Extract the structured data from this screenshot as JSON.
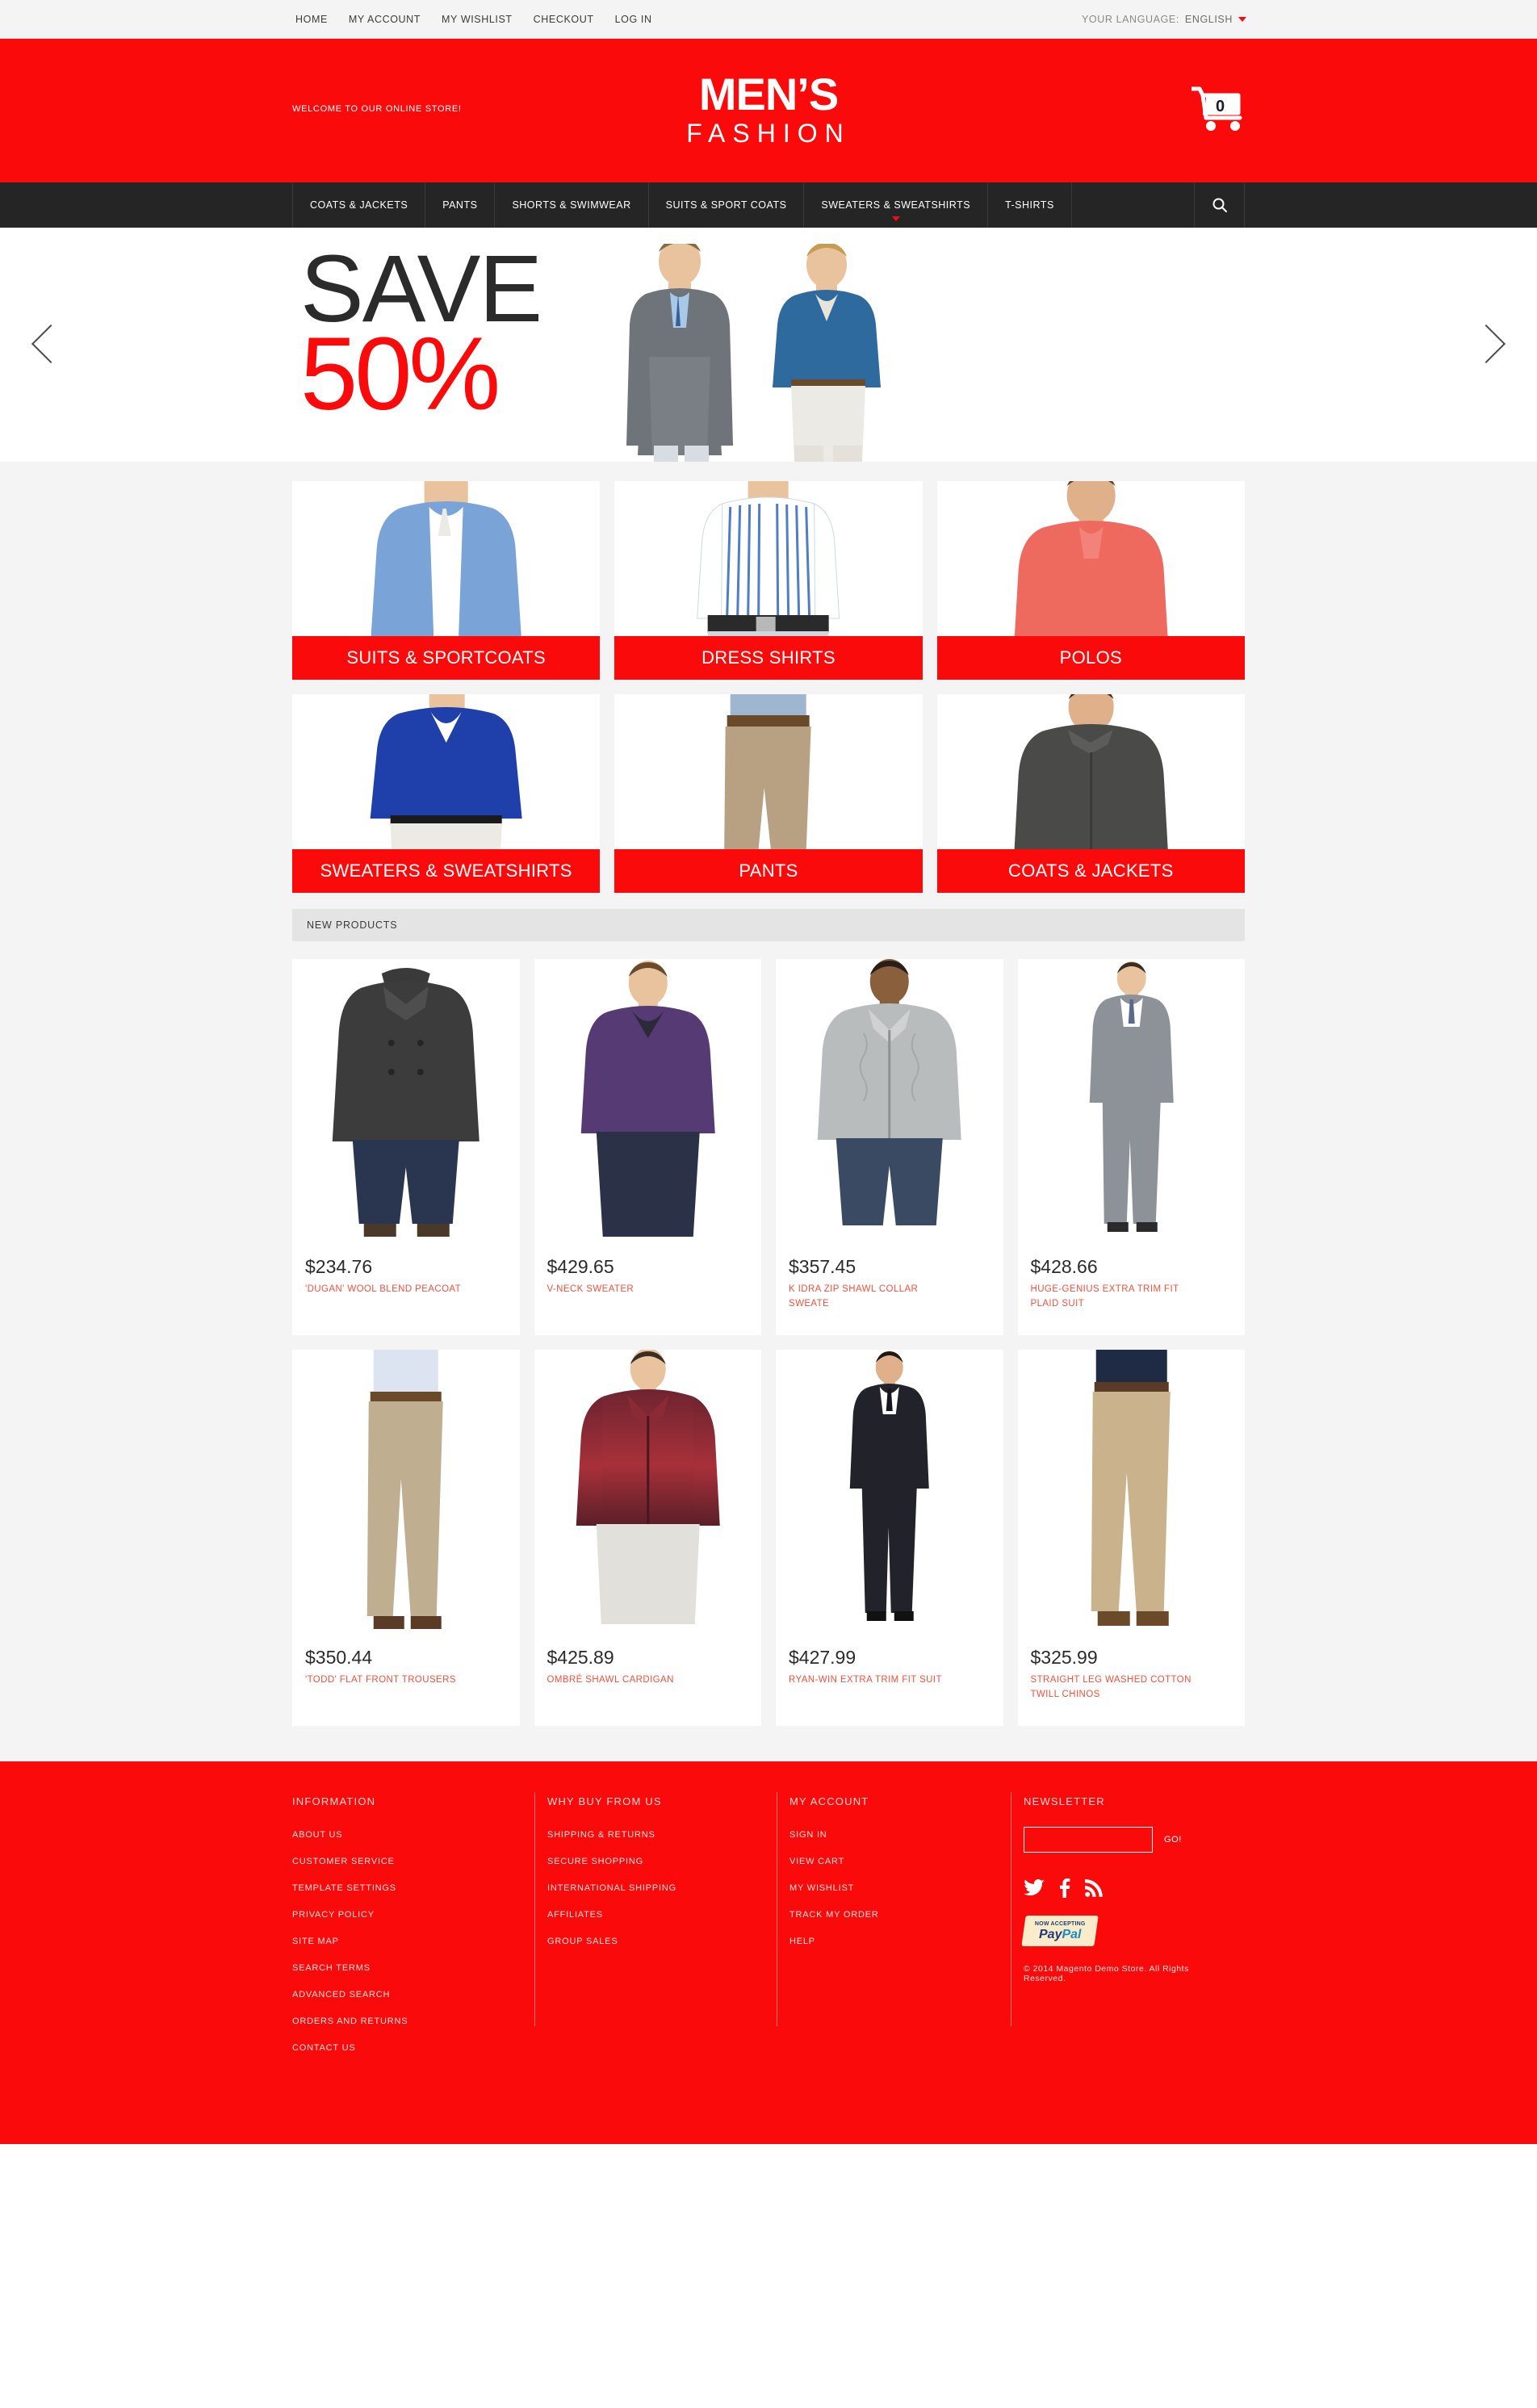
{
  "topbar": {
    "links": [
      {
        "label": "HOME"
      },
      {
        "label": "MY ACCOUNT"
      },
      {
        "label": "MY WISHLIST"
      },
      {
        "label": "CHECKOUT"
      },
      {
        "label": "LOG IN"
      }
    ],
    "language_label": "YOUR LANGUAGE:",
    "language_value": "ENGLISH"
  },
  "header": {
    "welcome": "WELCOME TO OUR ONLINE STORE!",
    "logo_line1": "MEN’S",
    "logo_line2": "FASHION",
    "cart_count": "0",
    "brand_color": "#fa0a0a"
  },
  "nav": {
    "items": [
      {
        "label": "COATS & JACKETS",
        "active": false
      },
      {
        "label": "PANTS",
        "active": false
      },
      {
        "label": "SHORTS & SWIMWEAR",
        "active": false
      },
      {
        "label": "SUITS & SPORT COATS",
        "active": false
      },
      {
        "label": "SWEATERS & SWEATSHIRTS",
        "active": true
      },
      {
        "label": "T-SHIRTS",
        "active": false
      }
    ],
    "search_icon": "search-icon"
  },
  "hero": {
    "line1": "SAVE",
    "line2": "50%",
    "prev_icon": "chevron-left-icon",
    "next_icon": "chevron-right-icon"
  },
  "categories": [
    {
      "label": "SUITS & SPORTCOATS"
    },
    {
      "label": "DRESS SHIRTS"
    },
    {
      "label": "POLOS"
    },
    {
      "label": "SWEATERS & SWEATSHIRTS"
    },
    {
      "label": "PANTS"
    },
    {
      "label": "COATS & JACKETS"
    }
  ],
  "new_products": {
    "heading": "NEW PRODUCTS",
    "items": [
      {
        "price": "$234.76",
        "name": "'DUGAN' WOOL BLEND PEACOAT"
      },
      {
        "price": "$429.65",
        "name": "V-NECK SWEATER"
      },
      {
        "price": "$357.45",
        "name": "K IDRA ZIP SHAWL COLLAR SWEATE"
      },
      {
        "price": "$428.66",
        "name": "HUGE-GENIUS EXTRA TRIM FIT PLAID SUIT"
      },
      {
        "price": "$350.44",
        "name": "'TODD' FLAT FRONT TROUSERS"
      },
      {
        "price": "$425.89",
        "name": "OMBRÉ SHAWL CARDIGAN"
      },
      {
        "price": "$427.99",
        "name": "RYAN-WIN EXTRA TRIM FIT SUIT"
      },
      {
        "price": "$325.99",
        "name": "STRAIGHT LEG WASHED COTTON TWILL CHINOS"
      }
    ]
  },
  "footer": {
    "col1": {
      "title": "INFORMATION",
      "links": [
        {
          "label": "ABOUT US"
        },
        {
          "label": "CUSTOMER SERVICE"
        },
        {
          "label": "TEMPLATE SETTINGS"
        },
        {
          "label": "PRIVACY POLICY"
        },
        {
          "label": "SITE MAP"
        },
        {
          "label": "SEARCH TERMS"
        },
        {
          "label": "ADVANCED SEARCH"
        },
        {
          "label": "ORDERS AND RETURNS"
        },
        {
          "label": "CONTACT US"
        }
      ]
    },
    "col2": {
      "title": "WHY BUY FROM US",
      "links": [
        {
          "label": "SHIPPING & RETURNS"
        },
        {
          "label": "SECURE SHOPPING"
        },
        {
          "label": "INTERNATIONAL SHIPPING"
        },
        {
          "label": "AFFILIATES"
        },
        {
          "label": "GROUP SALES"
        }
      ]
    },
    "col3": {
      "title": "MY ACCOUNT",
      "links": [
        {
          "label": "SIGN IN"
        },
        {
          "label": "VIEW CART"
        },
        {
          "label": "MY WISHLIST"
        },
        {
          "label": "TRACK MY ORDER"
        },
        {
          "label": "HELP"
        }
      ]
    },
    "col4": {
      "title": "NEWSLETTER",
      "input_value": "",
      "input_placeholder": "",
      "go_label": "GO!",
      "socials": [
        {
          "name": "twitter-icon"
        },
        {
          "name": "facebook-icon"
        },
        {
          "name": "rss-icon"
        }
      ],
      "paypal_top": "NOW ACCEPTING",
      "paypal_pay": "Pay",
      "paypal_pal": "Pal",
      "copyright": "© 2014 Magento Demo Store. All Rights Reserved."
    }
  }
}
